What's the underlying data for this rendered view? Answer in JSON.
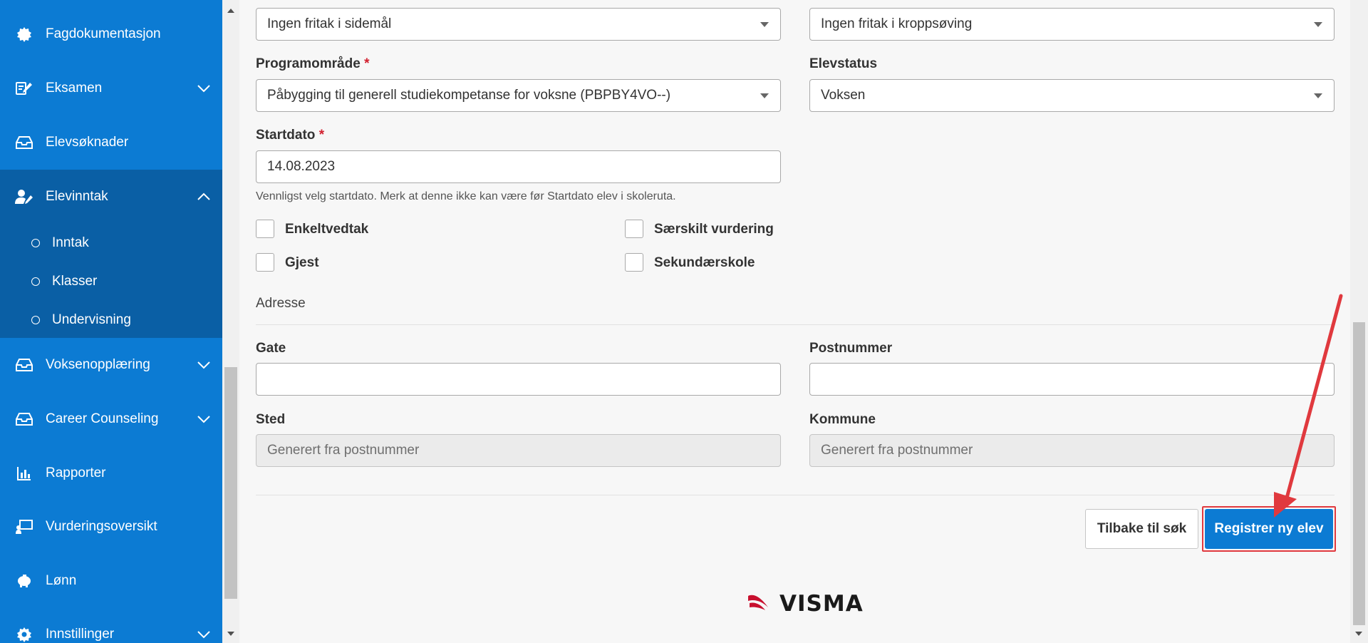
{
  "sidebar": {
    "items": [
      {
        "label": "Fagdokumentasjon",
        "icon": "gear-badge-icon"
      },
      {
        "label": "Eksamen",
        "icon": "edit-icon",
        "chevron": "down"
      },
      {
        "label": "Elevsøknader",
        "icon": "inbox-icon"
      },
      {
        "label": "Elevinntak",
        "icon": "user-edit-icon",
        "chevron": "up"
      },
      {
        "label": "Voksenopplæring",
        "icon": "inbox-icon",
        "chevron": "down"
      },
      {
        "label": "Career Counseling",
        "icon": "inbox-icon",
        "chevron": "down"
      },
      {
        "label": "Rapporter",
        "icon": "bar-chart-icon"
      },
      {
        "label": "Vurderingsoversikt",
        "icon": "presentation-icon"
      },
      {
        "label": "Lønn",
        "icon": "piggy-bank-icon"
      },
      {
        "label": "Innstillinger",
        "icon": "settings-icon",
        "chevron": "down"
      }
    ],
    "subitems": [
      {
        "label": "Inntak"
      },
      {
        "label": "Klasser"
      },
      {
        "label": "Undervisning"
      }
    ]
  },
  "form": {
    "fritak_sidemal": {
      "value": "Ingen fritak i sidemål"
    },
    "fritak_kroppsoving": {
      "value": "Ingen fritak i kroppsøving"
    },
    "programomrade": {
      "label": "Programområde",
      "required": "*",
      "value": "Påbygging til generell studiekompetanse for voksne (PBPBY4VO--)"
    },
    "elevstatus": {
      "label": "Elevstatus",
      "value": "Voksen"
    },
    "startdato": {
      "label": "Startdato",
      "required": "*",
      "value": "14.08.2023",
      "help": "Vennligst velg startdato. Merk at denne ikke kan være før Startdato elev i skoleruta."
    },
    "checkboxes": [
      {
        "label": "Enkeltvedtak"
      },
      {
        "label": "Særskilt vurdering"
      },
      {
        "label": "Gjest"
      },
      {
        "label": "Sekundærskole"
      }
    ],
    "adresse_title": "Adresse",
    "gate": {
      "label": "Gate",
      "value": ""
    },
    "postnummer": {
      "label": "Postnummer",
      "value": ""
    },
    "sted": {
      "label": "Sted",
      "placeholder": "Generert fra postnummer"
    },
    "kommune": {
      "label": "Kommune",
      "placeholder": "Generert fra postnummer"
    }
  },
  "actions": {
    "back_label": "Tilbake til søk",
    "register_label": "Registrer ny elev"
  },
  "footer": {
    "brand": "VISMA"
  },
  "colors": {
    "primary": "#0c7bd3",
    "sidebar_active": "#0a5fa5",
    "annotation": "#e0393e"
  }
}
